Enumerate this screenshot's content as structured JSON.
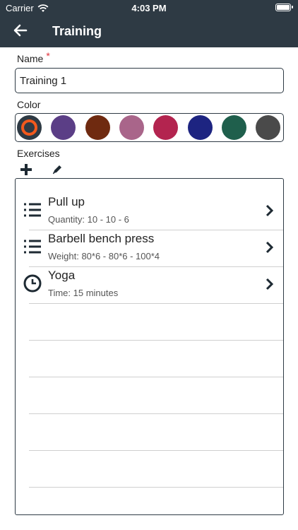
{
  "status_bar": {
    "carrier": "Carrier",
    "time": "4:03 PM"
  },
  "nav": {
    "title": "Training",
    "back_icon": "arrow-left-icon"
  },
  "form": {
    "name_label": "Name",
    "required_mark": "*",
    "name_value": "Training 1",
    "color_label": "Color",
    "exercises_label": "Exercises"
  },
  "colors": [
    {
      "hex": "#2e3a44",
      "selected": true
    },
    {
      "hex": "#5b3e86",
      "selected": false
    },
    {
      "hex": "#6f2a10",
      "selected": false
    },
    {
      "hex": "#a9658a",
      "selected": false
    },
    {
      "hex": "#b3244f",
      "selected": false
    },
    {
      "hex": "#1d2481",
      "selected": false
    },
    {
      "hex": "#1f5f4c",
      "selected": false
    },
    {
      "hex": "#4a4a4a",
      "selected": false
    }
  ],
  "accent_color": "#f2591d",
  "toolbar": {
    "add_icon": "plus-icon",
    "edit_icon": "pencil-icon"
  },
  "exercises": [
    {
      "title": "Pull up",
      "subtitle": "Quantity: 10 - 10 - 6",
      "icon": "list-icon"
    },
    {
      "title": "Barbell bench press",
      "subtitle": "Weight: 80*6 - 80*6 - 100*4",
      "icon": "list-icon"
    },
    {
      "title": "Yoga",
      "subtitle": "Time: 15 minutes",
      "icon": "clock-icon"
    }
  ]
}
